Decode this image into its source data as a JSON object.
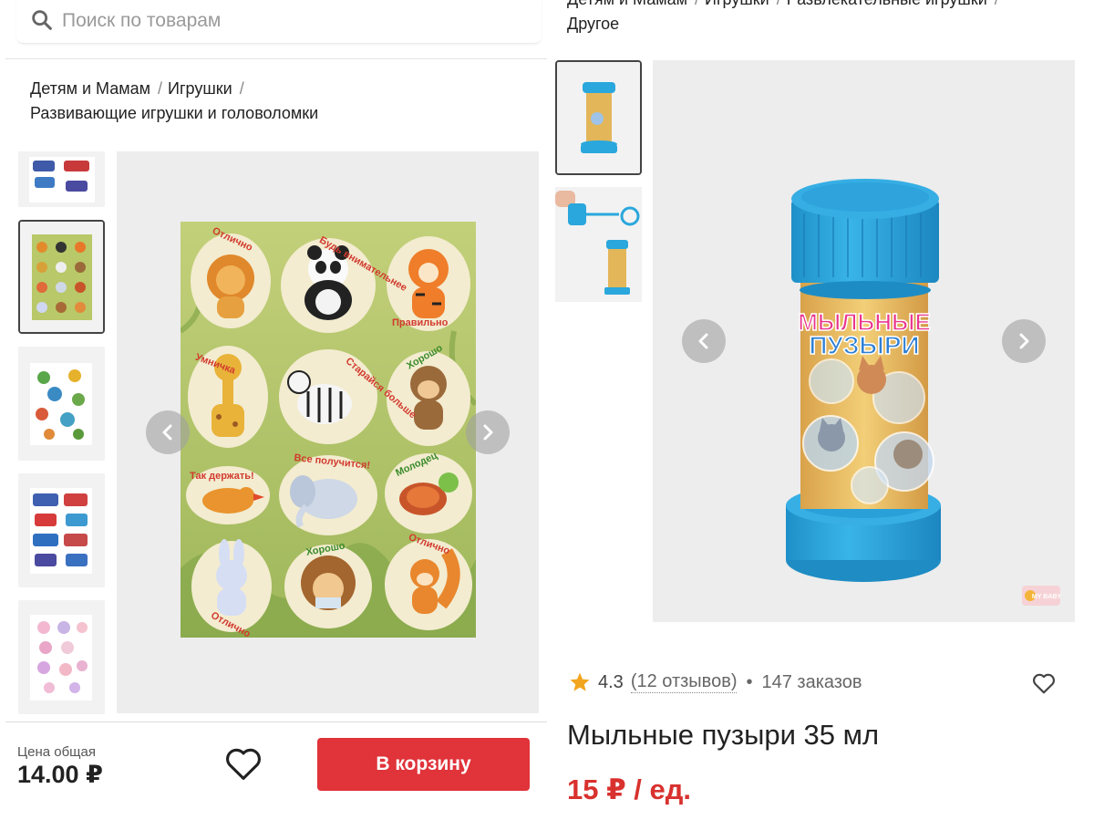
{
  "left": {
    "search": {
      "placeholder": "Поиск по товарам"
    },
    "breadcrumb": {
      "items": [
        "Детям и Мамам",
        "Игрушки",
        "Развивающие игрушки и головоломки"
      ],
      "separator": "/"
    },
    "stickers": {
      "words": [
        "Отлично",
        "Будь внимательнее",
        "Правильно",
        "Умничка",
        "Старайся больше",
        "Хорошо",
        "Так держать!",
        "Все получится!",
        "Молодец",
        "Хорошо",
        "Отлично",
        "Отлично"
      ]
    },
    "bottom": {
      "price_label": "Цена общая",
      "price_total": "14.00 ₽",
      "cart_button": "В корзину"
    }
  },
  "right": {
    "breadcrumb": {
      "items": [
        "Детям и Мамам",
        "Игрушки",
        "Развлекательные игрушки",
        "Другое"
      ],
      "separator": "/"
    },
    "product_label": {
      "line1": "МЫЛЬНЫЕ",
      "line2": "ПУЗЫРИ",
      "brand": "MY BABY"
    },
    "rating": "4.3",
    "reviews": "(12 отзывов)",
    "orders": "147 заказов",
    "title": "Мыльные пузыри 35 мл",
    "price": "15 ₽ / ед."
  },
  "colors": {
    "accent": "#e0333a",
    "price": "#d8312e",
    "star": "#f2a51f",
    "bottle_blue": "#2aa7dc"
  },
  "icons": [
    "search-icon",
    "chevron-left-icon",
    "chevron-right-icon",
    "heart-icon",
    "star-icon"
  ]
}
